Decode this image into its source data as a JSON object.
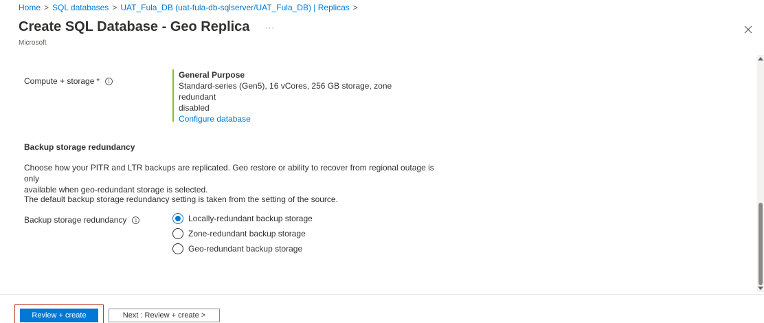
{
  "breadcrumb": {
    "items": [
      "Home",
      "SQL databases",
      "UAT_Fula_DB (uat-fula-db-sqlserver/UAT_Fula_DB) | Replicas"
    ],
    "separator": ">"
  },
  "header": {
    "title": "Create SQL Database - Geo Replica",
    "more": "···",
    "subtitle": "Microsoft"
  },
  "compute": {
    "label": "Compute + storage",
    "required_mark": "*",
    "info": "i",
    "tier": "General Purpose",
    "description_line1": "Standard-series (Gen5), 16 vCores, 256 GB storage, zone redundant",
    "description_line2": "disabled",
    "configure_link": "Configure database"
  },
  "backup": {
    "heading": "Backup storage redundancy",
    "desc_line1": "Choose how your PITR and LTR backups are replicated. Geo restore or ability to recover from regional outage is only",
    "desc_line2": "available when geo-redundant storage is selected.",
    "default_note": "The default backup storage redundancy setting is taken from the setting of the source.",
    "field_label": "Backup storage redundancy",
    "info": "i",
    "options": [
      {
        "label": "Locally-redundant backup storage",
        "selected": true
      },
      {
        "label": "Zone-redundant backup storage",
        "selected": false
      },
      {
        "label": "Geo-redundant backup storage",
        "selected": false
      }
    ]
  },
  "footer": {
    "primary_label": "Review + create",
    "secondary_label": "Next : Review + create >"
  },
  "colors": {
    "accent": "#0078d4",
    "compute_bar": "#8cbd18",
    "highlight": "#c0392b"
  }
}
